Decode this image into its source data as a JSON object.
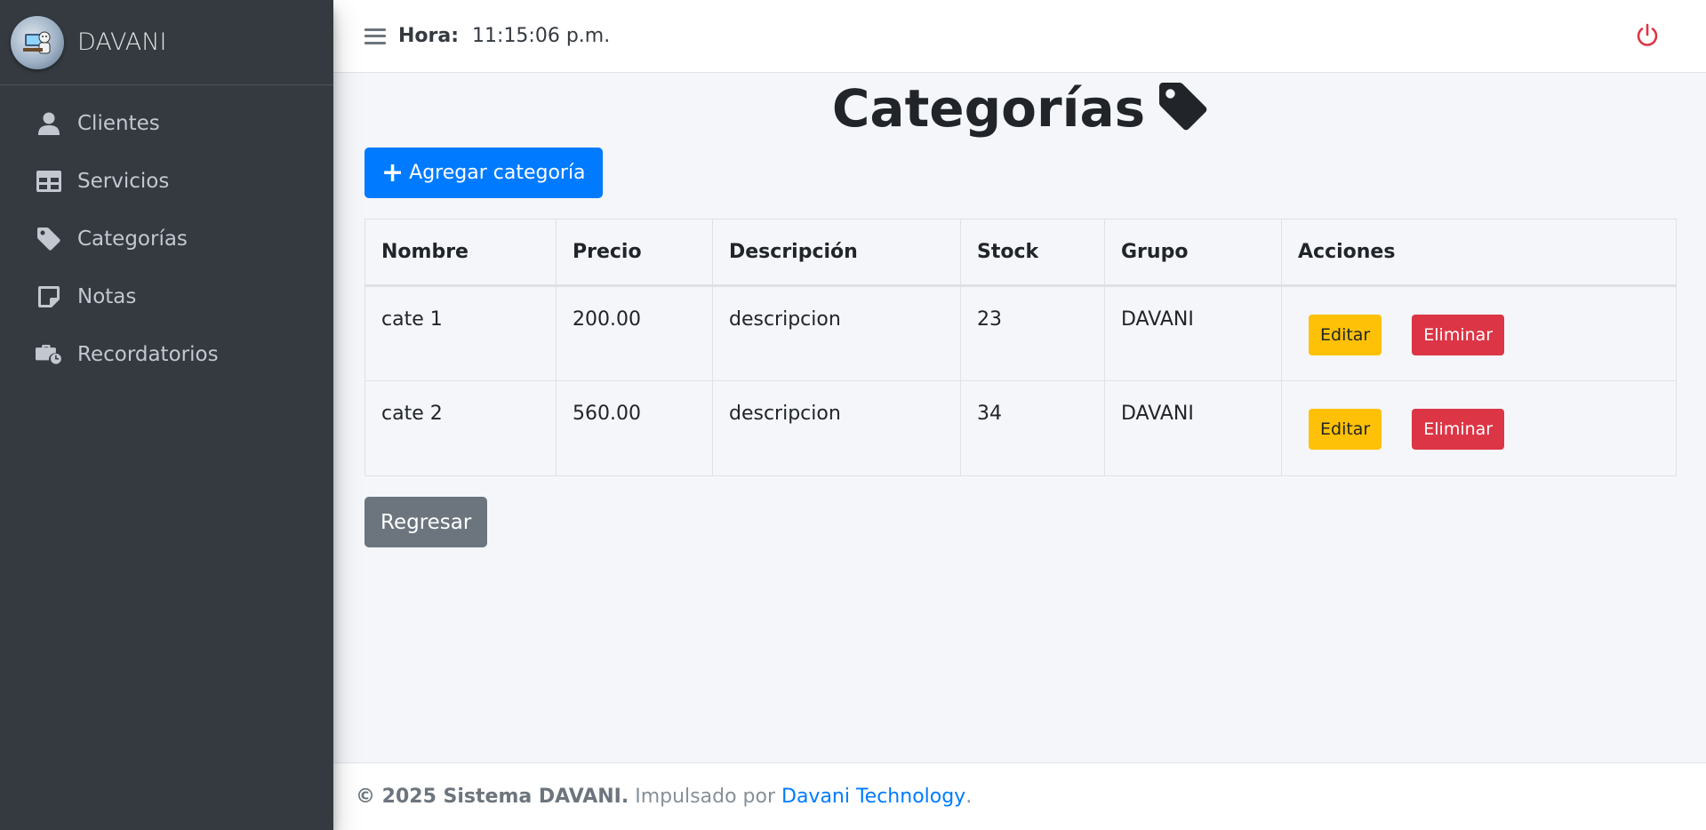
{
  "brand": {
    "name": "DAVANI"
  },
  "sidebar": {
    "items": [
      {
        "label": "Clientes",
        "icon": "user-icon"
      },
      {
        "label": "Servicios",
        "icon": "table-icon"
      },
      {
        "label": "Categorías",
        "icon": "tag-icon"
      },
      {
        "label": "Notas",
        "icon": "note-icon"
      },
      {
        "label": "Recordatorios",
        "icon": "briefcase-clock-icon"
      }
    ]
  },
  "header": {
    "hora_label": "Hora:",
    "hora_value": "11:15:06 p.m."
  },
  "main": {
    "title": "Categorías",
    "add_button": "Agregar categoría",
    "back_button": "Regresar",
    "table": {
      "headers": [
        "Nombre",
        "Precio",
        "Descripción",
        "Stock",
        "Grupo",
        "Acciones"
      ],
      "rows": [
        {
          "nombre": "cate 1",
          "precio": "200.00",
          "descripcion": "descripcion",
          "stock": "23",
          "grupo": "DAVANI"
        },
        {
          "nombre": "cate 2",
          "precio": "560.00",
          "descripcion": "descripcion",
          "stock": "34",
          "grupo": "DAVANI"
        }
      ],
      "edit_label": "Editar",
      "delete_label": "Eliminar"
    }
  },
  "footer": {
    "copyright": "© 2025 Sistema DAVANI.",
    "powered": "Impulsado por",
    "link": "Davani Technology",
    "period": "."
  },
  "colors": {
    "sidebar_bg": "#343a40",
    "primary": "#007bff",
    "warning": "#ffc107",
    "danger": "#dc3545",
    "secondary": "#6c757d",
    "power": "#dc3545"
  }
}
